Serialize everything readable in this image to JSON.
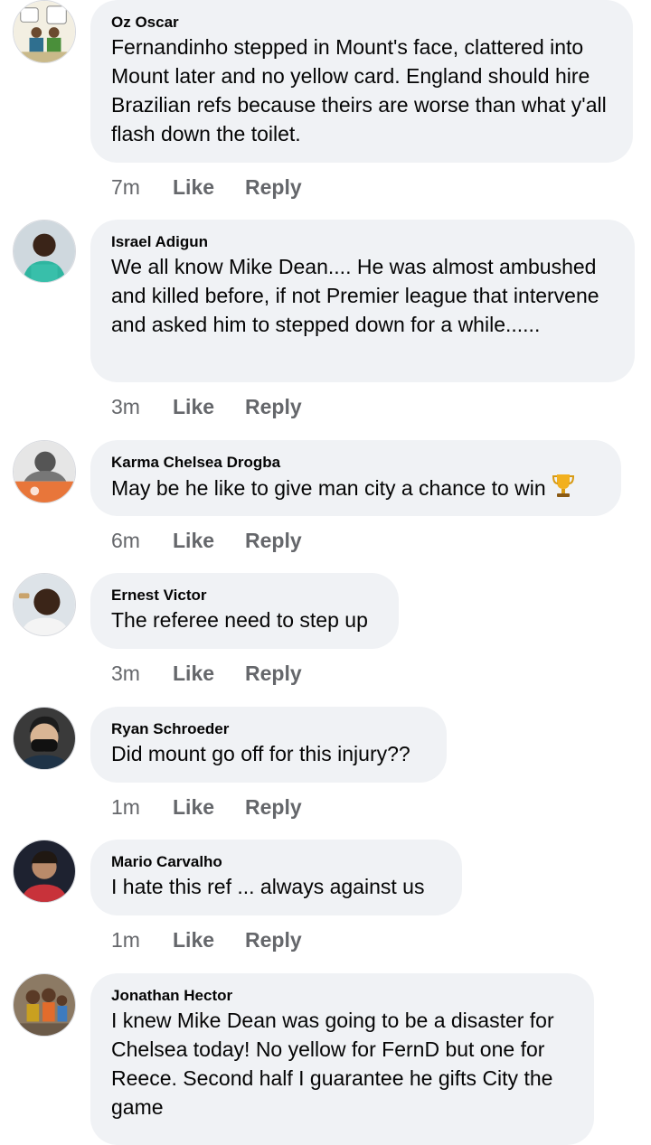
{
  "comments": [
    {
      "author": "Oz Oscar",
      "text": "Fernandinho stepped in Mount's face, clattered into Mount later and no yellow card. England should hire Brazilian refs because theirs are worse than what y'all flash down the toilet.",
      "time": "7m",
      "like": "Like",
      "reply": "Reply"
    },
    {
      "author": "Israel Adigun",
      "text": "We all know Mike Dean.... He was almost ambushed and killed before, if not Premier league that intervene and asked him to stepped down for a while......",
      "time": "3m",
      "like": "Like",
      "reply": "Reply"
    },
    {
      "author": "Karma Chelsea Drogba",
      "text": "May be he like to give man city a chance to win",
      "emoji": "trophy-icon",
      "time": "6m",
      "like": "Like",
      "reply": "Reply"
    },
    {
      "author": "Ernest Victor",
      "text": "The referee need to step up",
      "time": "3m",
      "like": "Like",
      "reply": "Reply"
    },
    {
      "author": "Ryan Schroeder",
      "text": "Did mount go off for this injury??",
      "time": "1m",
      "like": "Like",
      "reply": "Reply"
    },
    {
      "author": "Mario Carvalho",
      "text": "I hate this ref ... always against us",
      "time": "1m",
      "like": "Like",
      "reply": "Reply"
    },
    {
      "author": "Jonathan Hector",
      "text": "I knew Mike Dean was going to be a disaster for Chelsea today! No yellow for FernD but one for Reece. Second half I guarantee he gifts City the game"
    }
  ],
  "colors": {
    "bubble": "#f0f2f5",
    "meta": "#65676b",
    "text": "#050505"
  }
}
